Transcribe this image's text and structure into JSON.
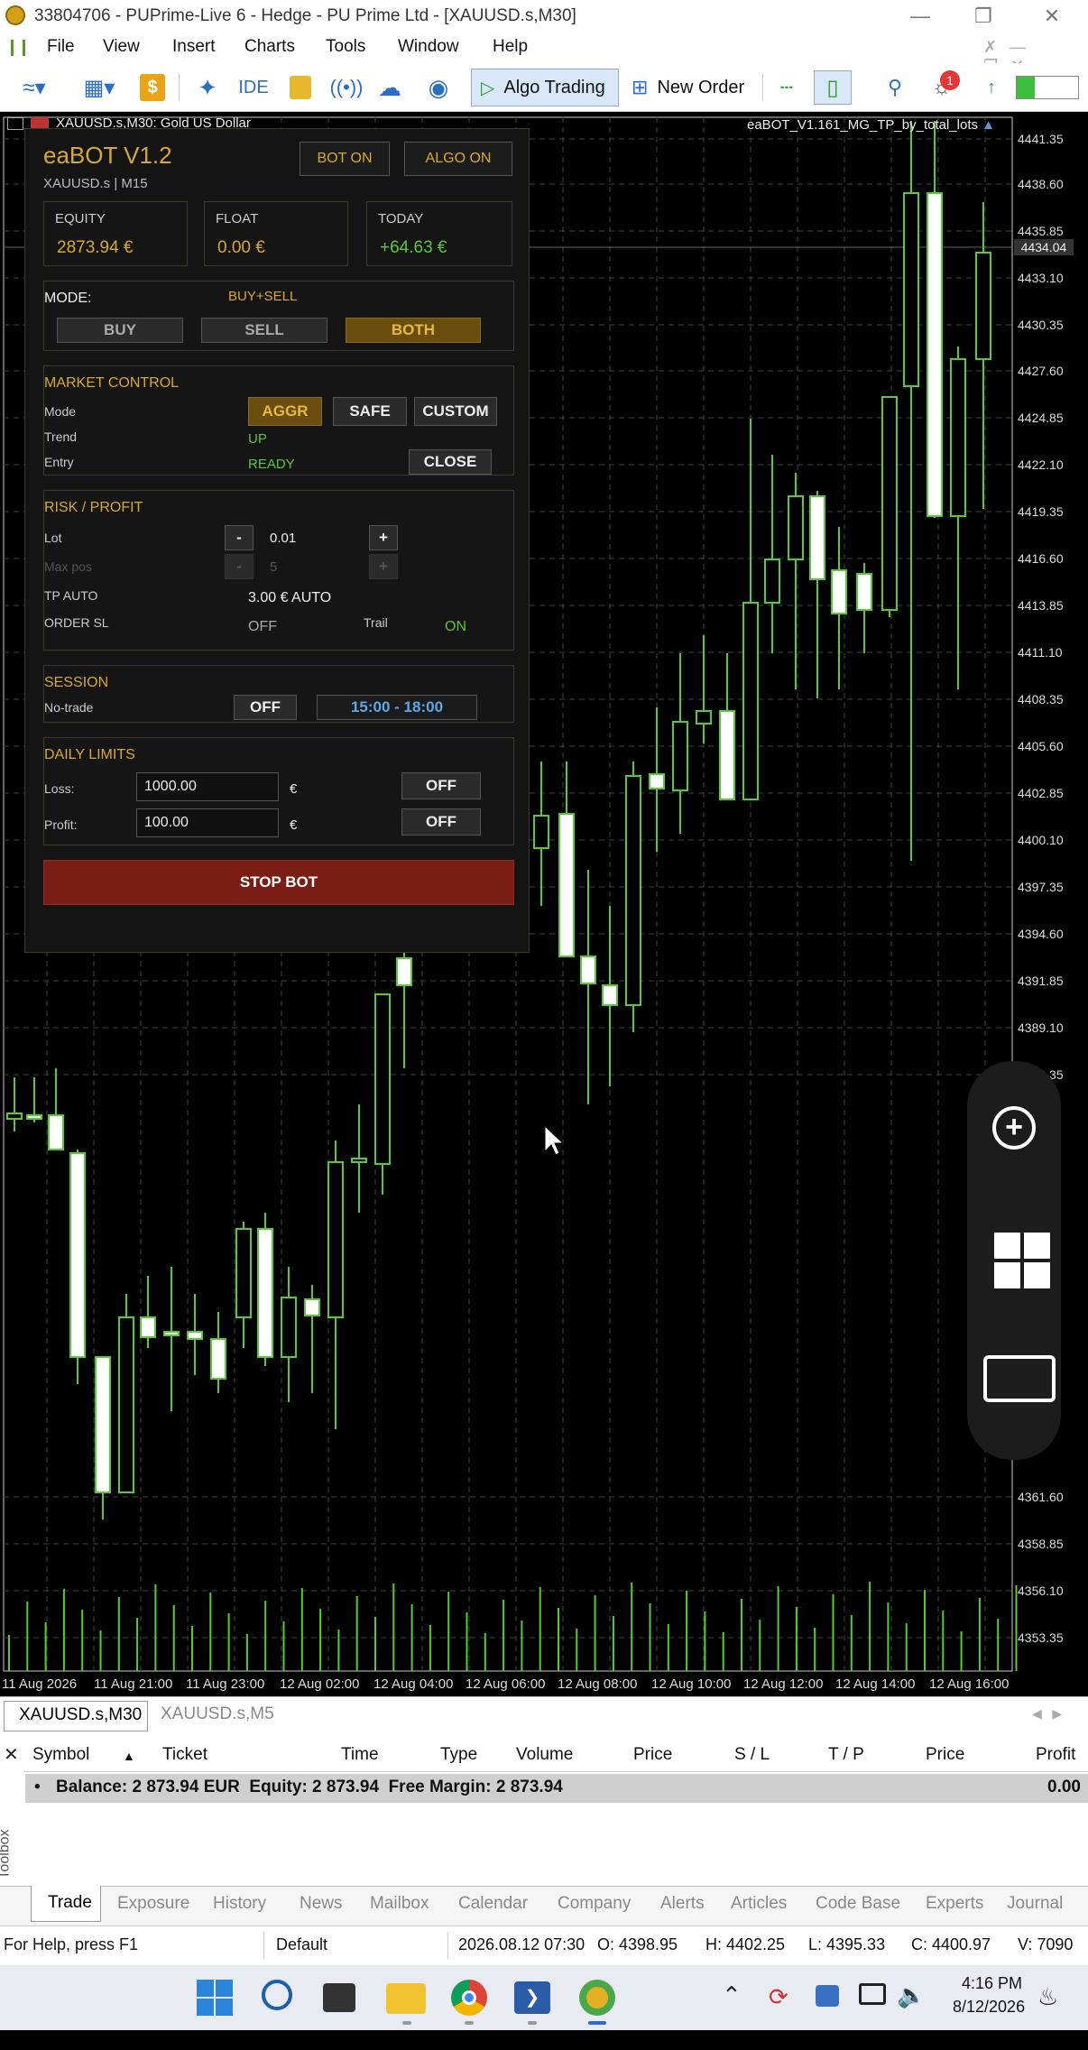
{
  "window": {
    "title": "33804706 - PUPrime-Live 6 - Hedge - PU Prime Ltd - [XAUUSD.s,M30]"
  },
  "menu": [
    "File",
    "View",
    "Insert",
    "Charts",
    "Tools",
    "Window",
    "Help"
  ],
  "toolbar": {
    "ide": "IDE",
    "algo_trading": "Algo Trading",
    "new_order": "New Order",
    "notif_count": "1"
  },
  "chart": {
    "symbol_desc": "XAUUSD.s,M30:  Gold US Dollar",
    "ea_label": "eaBOT_V1.161_MG_TP_by_total_lots",
    "current_price": "4434.04",
    "price_labels": [
      "4441.35",
      "4438.60",
      "4435.85",
      "4433.10",
      "4430.35",
      "4427.60",
      "4424.85",
      "4422.10",
      "4419.35",
      "4416.60",
      "4413.85",
      "4411.10",
      "4408.35",
      "4405.60",
      "4402.85",
      "4400.10",
      "4397.35",
      "4394.60",
      "4391.85",
      "4389.10",
      "4386.35",
      "4361.60",
      "4358.85",
      "4356.10",
      "4353.35"
    ],
    "time_labels": [
      "11 Aug 2026",
      "11 Aug 21:00",
      "11 Aug 23:00",
      "12 Aug 02:00",
      "12 Aug 04:00",
      "12 Aug 06:00",
      "12 Aug 08:00",
      "12 Aug 10:00",
      "12 Aug 12:00",
      "12 Aug 14:00",
      "12 Aug 16:00"
    ]
  },
  "panel": {
    "title": "eaBOT V1.2",
    "subtitle": "XAUUSD.s | M15",
    "bot_on": "BOT ON",
    "algo_on": "ALGO ON",
    "equity_label": "EQUITY",
    "equity_value": "2873.94 €",
    "float_label": "FLOAT",
    "float_value": "0.00 €",
    "today_label": "TODAY",
    "today_value": "+64.63 €",
    "mode_label": "MODE:",
    "mode_value": "BUY+SELL",
    "buy": "BUY",
    "sell": "SELL",
    "both": "BOTH",
    "market_control": "MARKET CONTROL",
    "mc_mode": "Mode",
    "aggr": "AGGR",
    "safe": "SAFE",
    "custom": "CUSTOM",
    "trend_label": "Trend",
    "trend_value": "UP",
    "entry_label": "Entry",
    "entry_value": "READY",
    "close": "CLOSE",
    "risk_profit": "RISK / PROFIT",
    "lot_label": "Lot",
    "lot_value": "0.01",
    "minus": "-",
    "plus": "+",
    "maxpos_label": "Max pos",
    "maxpos_value": "5",
    "tp_auto_label": "TP AUTO",
    "tp_auto_value": "3.00 € AUTO",
    "order_sl_label": "ORDER SL",
    "order_sl_value": "OFF",
    "trail_label": "Trail",
    "trail_value": "ON",
    "session": "SESSION",
    "notrade_label": "No-trade",
    "session_off": "OFF",
    "session_time": "15:00 - 18:00",
    "daily_limits": "DAILY LIMITS",
    "loss_label": "Loss:",
    "loss_value": "1000.00",
    "profit_label": "Profit:",
    "profit_value": "100.00",
    "euro": "€",
    "loss_off": "OFF",
    "profit_off": "OFF",
    "stop_bot": "STOP BOT"
  },
  "symbol_tabs": [
    "XAUUSD.s,M30",
    "XAUUSD.s,M5"
  ],
  "toolbox": {
    "side_label": "Toolbox",
    "headers": [
      "Symbol",
      "Ticket",
      "Time",
      "Type",
      "Volume",
      "Price",
      "S / L",
      "T / P",
      "Price",
      "Profit"
    ],
    "balance_row": "Balance: 2 873.94 EUR  Equity: 2 873.94  Free Margin: 2 873.94",
    "balance_profit": "0.00",
    "tabs": [
      "Trade",
      "Exposure",
      "History",
      "News",
      "Mailbox",
      "Calendar",
      "Company",
      "Alerts",
      "Articles",
      "Code Base",
      "Experts",
      "Journal"
    ]
  },
  "status": {
    "help": "For Help, press F1",
    "profile": "Default",
    "datetime": "2026.08.12 07:30",
    "open": "O: 4398.95",
    "high": "H: 4402.25",
    "low": "L: 4395.33",
    "close": "C: 4400.97",
    "volume": "V: 7090"
  },
  "taskbar": {
    "time": "4:16 PM",
    "date": "8/12/2026"
  }
}
